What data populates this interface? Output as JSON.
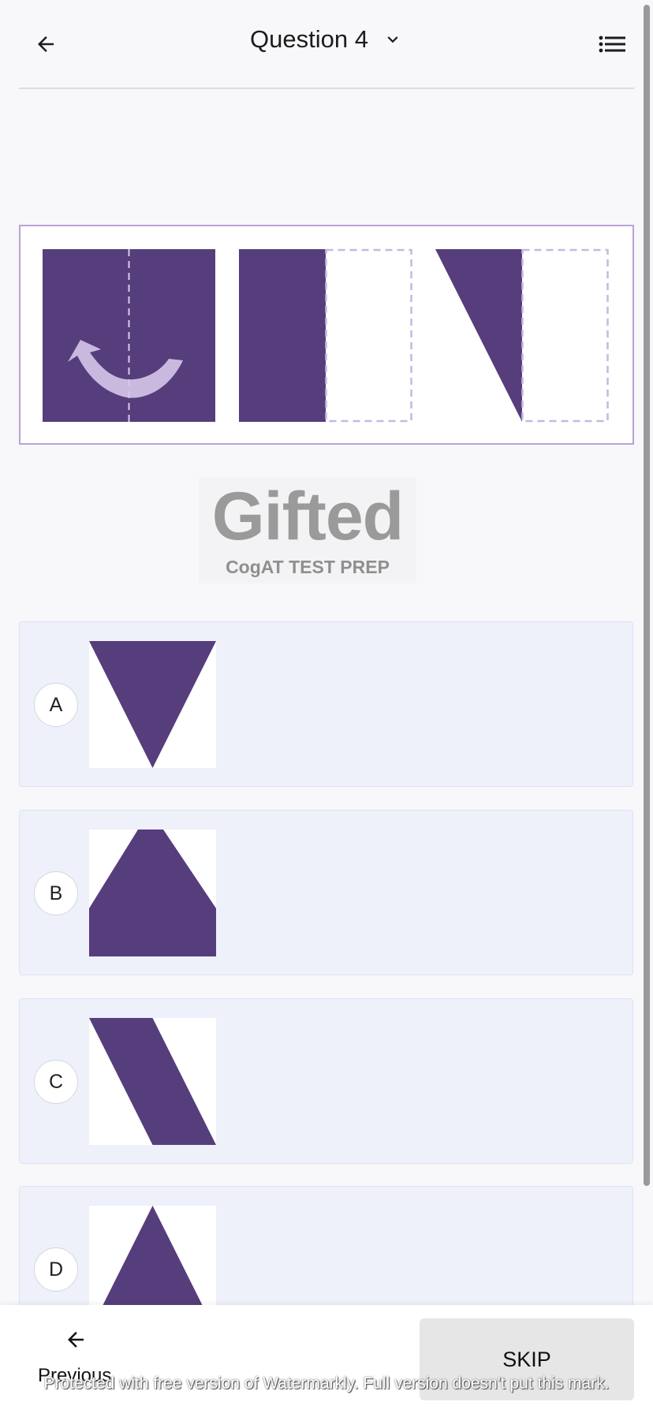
{
  "header": {
    "title": "Question 4",
    "back_icon": "arrow-left-icon",
    "dropdown_icon": "chevron-down-icon",
    "menu_icon": "list-icon"
  },
  "colors": {
    "shape": "#563d7c",
    "dashed": "#c9b6e2",
    "panel_border": "#b9a3d6",
    "option_bg": "#eef0fa",
    "skip_bg": "#e6e6e6"
  },
  "logo": {
    "main": "Gifted",
    "sub": "CogAT TEST PREP"
  },
  "options": [
    {
      "letter": "A",
      "shape": "downward-triangle"
    },
    {
      "letter": "B",
      "shape": "house-pentagon"
    },
    {
      "letter": "C",
      "shape": "diagonal-band"
    },
    {
      "letter": "D",
      "shape": "upward-triangle"
    }
  ],
  "footer": {
    "previous_label": "Previous",
    "skip_label": "SKIP",
    "previous_icon": "arrow-left-icon"
  },
  "watermark": "Protected with free version of Watermarkly. Full version doesn't put this mark."
}
